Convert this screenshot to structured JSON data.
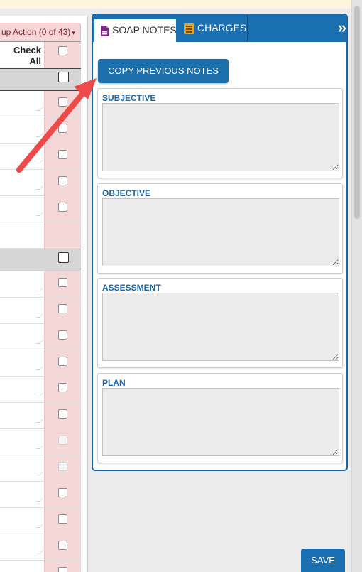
{
  "group_action": {
    "label": "up Action (0 of 43)",
    "caret": "▾"
  },
  "grid": {
    "check_all_label": "Check All",
    "rows": [
      {
        "type": "head"
      },
      {
        "type": "group"
      },
      {
        "type": "row",
        "disabled": false
      },
      {
        "type": "row",
        "disabled": false
      },
      {
        "type": "row",
        "disabled": false
      },
      {
        "type": "row",
        "disabled": false
      },
      {
        "type": "row",
        "disabled": false
      },
      {
        "type": "spacer"
      },
      {
        "type": "group"
      },
      {
        "type": "row",
        "disabled": false
      },
      {
        "type": "row",
        "disabled": false
      },
      {
        "type": "row",
        "disabled": false
      },
      {
        "type": "row",
        "disabled": false
      },
      {
        "type": "row",
        "disabled": false
      },
      {
        "type": "row",
        "disabled": false
      },
      {
        "type": "row",
        "disabled": true
      },
      {
        "type": "row",
        "disabled": true
      },
      {
        "type": "row",
        "disabled": false
      },
      {
        "type": "row",
        "disabled": false
      },
      {
        "type": "row",
        "disabled": false
      },
      {
        "type": "row",
        "disabled": false
      }
    ]
  },
  "tabs": {
    "soap_notes": "SOAP NOTES",
    "charges": "CHARGES",
    "collapse": "»"
  },
  "copy_button": "COPY PREVIOUS NOTES",
  "sections": [
    {
      "label": "SUBJECTIVE",
      "value": ""
    },
    {
      "label": "OBJECTIVE",
      "value": ""
    },
    {
      "label": "ASSESSMENT",
      "value": ""
    },
    {
      "label": "PLAN",
      "value": ""
    }
  ],
  "save_button": "SAVE",
  "colors": {
    "accent": "#1a6fb0",
    "row_highlight": "#f6d7d8",
    "annotation_arrow": "#ee4a4a",
    "notes_icon": "#7b2a83",
    "charges_icon": "#e9a21a"
  }
}
